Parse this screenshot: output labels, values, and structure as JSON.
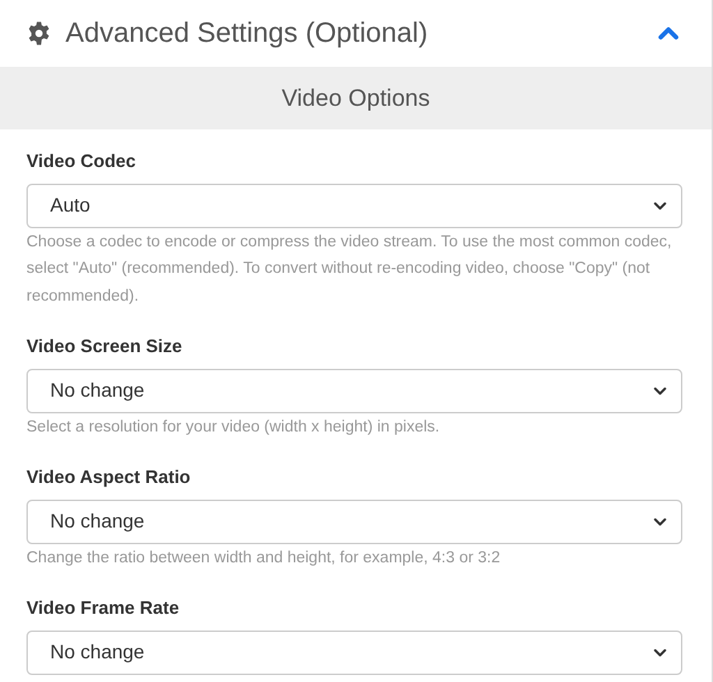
{
  "panel": {
    "title": "Advanced Settings (Optional)",
    "expanded": true
  },
  "section": {
    "title": "Video Options"
  },
  "fields": [
    {
      "label": "Video Codec",
      "value": "Auto",
      "help": "Choose a codec to encode or compress the video stream. To use the most common codec, select \"Auto\" (recommended). To convert without re-encoding video, choose \"Copy\" (not recommended)."
    },
    {
      "label": "Video Screen Size",
      "value": "No change",
      "help": "Select a resolution for your video (width x height) in pixels."
    },
    {
      "label": "Video Aspect Ratio",
      "value": "No change",
      "help": "Change the ratio between width and height, for example, 4:3 or 3:2"
    },
    {
      "label": "Video Frame Rate",
      "value": "No change"
    }
  ]
}
